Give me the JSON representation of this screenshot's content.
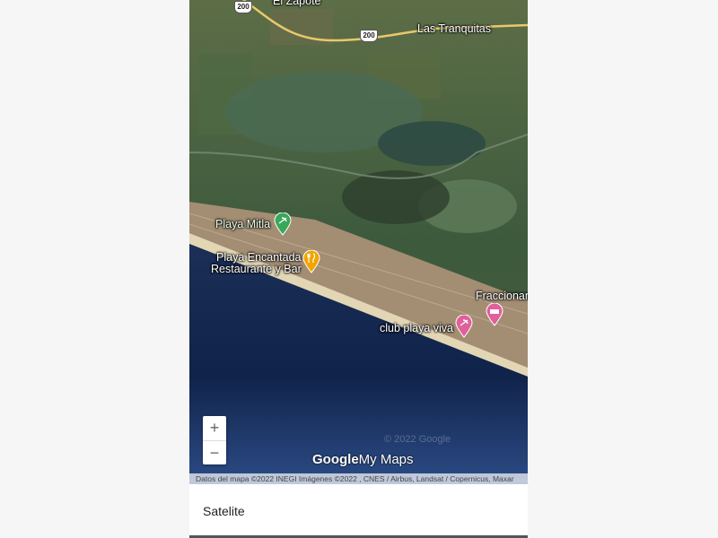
{
  "places": {
    "town1": "El Zapote",
    "town2": "Las Tranquitas",
    "highway": "200",
    "playa_mitla": "Playa Mitla",
    "restaurant_line1": "Playa Encantada",
    "restaurant_line2": "Restaurante y Bar",
    "fracc": "Fraccionam",
    "club": "club playa viva"
  },
  "watermark": "© 2022 Google",
  "logo": {
    "google": "Google",
    "mymaps": "My Maps"
  },
  "attribution": "Datos del mapa ©2022 INEGI Imágenes ©2022 , CNES / Airbus, Landsat / Copernicus, Maxar",
  "zoom": {
    "in": "+",
    "out": "−"
  },
  "layer_name": "Satelite",
  "colors": {
    "green_pin": "#3aa859",
    "orange_pin": "#f0a500",
    "pink_pin": "#e0609a"
  }
}
